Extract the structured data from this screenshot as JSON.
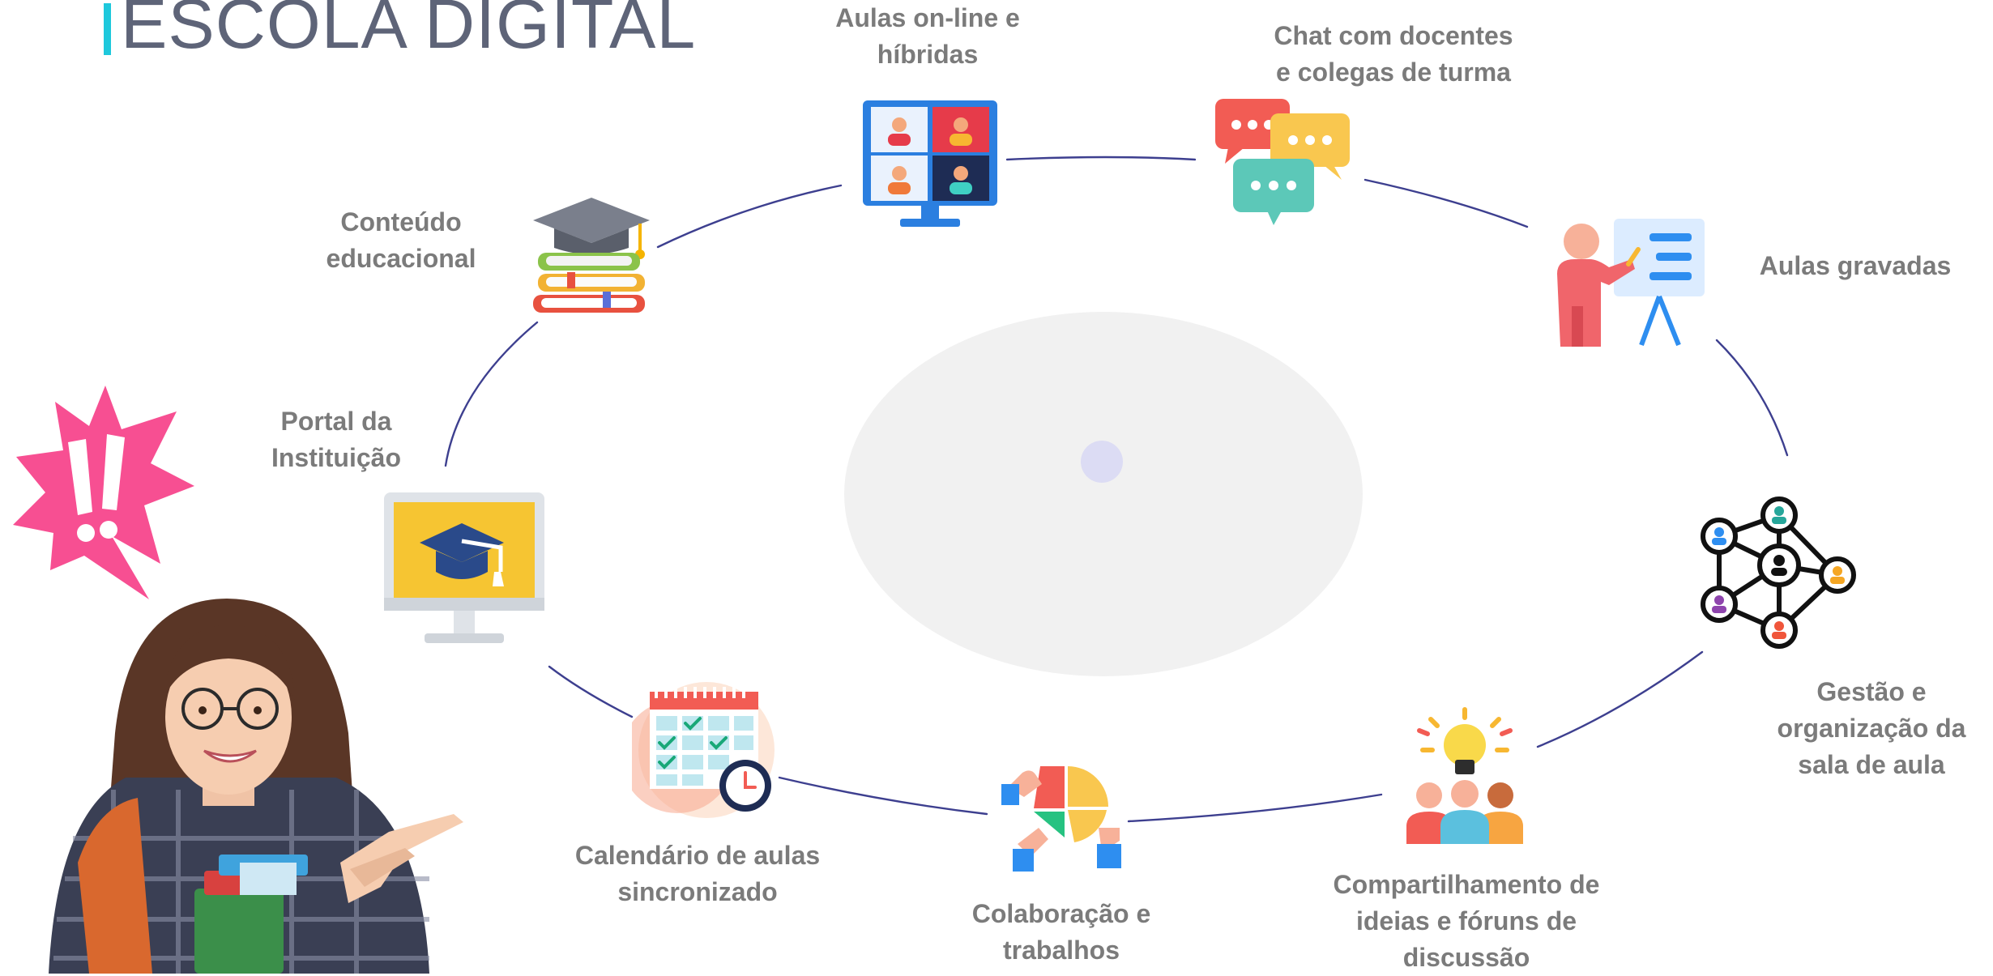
{
  "title": "ESCOLA DIGITAL",
  "nodes": {
    "aulas_online": "Aulas on-line e\nhíbridas",
    "chat": "Chat com docentes\ne colegas de turma",
    "aulas_gravadas": "Aulas gravadas",
    "gestao": "Gestão e\norganização da\nsala de aula",
    "compartilhamento": "Compartilhamento de\nideias e fóruns de\ndiscussão",
    "colaboracao": "Colaboração e\ntrabalhos",
    "calendario": "Calendário de aulas\nsincronizado",
    "portal": "Portal da\nInstituição",
    "conteudo": "Conteúdo\neducacional"
  },
  "colors": {
    "accent": "#1ec8dc",
    "title": "#5e6478",
    "label": "#7b7b7b",
    "ring": "#3d3f8f",
    "center_disc": "#f1f1f1",
    "center_dot": "#dcdcf4",
    "burst": "#f74f92"
  },
  "icons": {
    "aulas_online": "video-conference-monitor-icon",
    "chat": "chat-bubbles-icon",
    "aulas_gravadas": "teacher-whiteboard-icon",
    "gestao": "people-network-icon",
    "compartilhamento": "lightbulb-team-icon",
    "colaboracao": "puzzle-hands-icon",
    "calendario": "calendar-clock-icon",
    "portal": "graduation-monitor-icon",
    "conteudo": "books-graduation-cap-icon",
    "alert": "exclamation-burst-icon"
  }
}
